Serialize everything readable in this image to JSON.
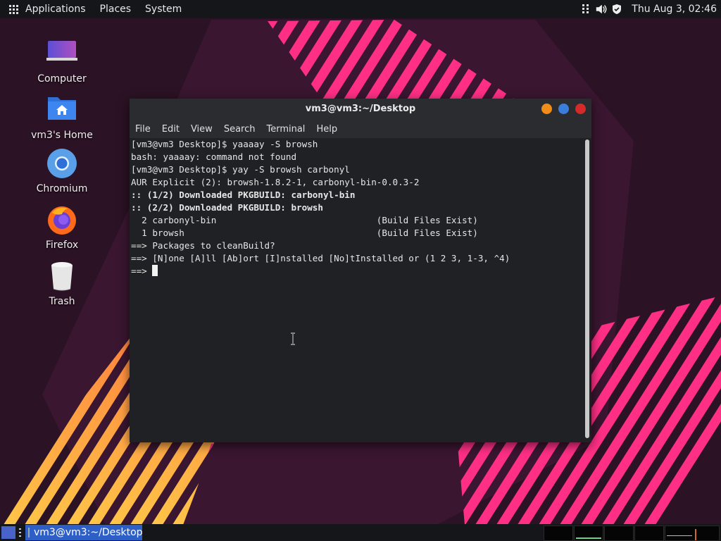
{
  "top_panel": {
    "menus": [
      "Applications",
      "Places",
      "System"
    ],
    "clock": "Thu Aug  3, 02:46",
    "tray_icons": [
      "network-icon",
      "volume-icon",
      "shield-icon"
    ]
  },
  "desktop_icons": [
    {
      "label": "Computer",
      "icon": "computer-icon"
    },
    {
      "label": "vm3's Home",
      "icon": "home-folder-icon"
    },
    {
      "label": "Chromium",
      "icon": "chromium-icon"
    },
    {
      "label": "Firefox",
      "icon": "firefox-icon"
    },
    {
      "label": "Trash",
      "icon": "trash-icon"
    }
  ],
  "window": {
    "title": "vm3@vm3:~/Desktop",
    "menu": [
      "File",
      "Edit",
      "View",
      "Search",
      "Terminal",
      "Help"
    ],
    "buttons": {
      "minimize": "#f08c1a",
      "maximize": "#3b7ddd",
      "close": "#d42a2a"
    }
  },
  "terminal": {
    "lines": [
      {
        "text": "[vm3@vm3 Desktop]$ yaaaay -S browsh",
        "bold": false
      },
      {
        "text": "bash: yaaaay: command not found",
        "bold": false
      },
      {
        "text": "[vm3@vm3 Desktop]$ yay -S browsh carbonyl",
        "bold": false
      },
      {
        "text": "AUR Explicit (2): browsh-1.8.2-1, carbonyl-bin-0.0.3-2",
        "bold": false
      },
      {
        "text": ":: (1/2) Downloaded PKGBUILD: carbonyl-bin",
        "bold": true
      },
      {
        "text": ":: (2/2) Downloaded PKGBUILD: browsh",
        "bold": true
      },
      {
        "text": "  2 carbonyl-bin                              (Build Files Exist)",
        "bold": false
      },
      {
        "text": "  1 browsh                                    (Build Files Exist)",
        "bold": false
      },
      {
        "text": "==> Packages to cleanBuild?",
        "bold": false
      },
      {
        "text": "==> [N]one [A]ll [Ab]ort [I]nstalled [No]tInstalled or (1 2 3, 1-3, ^4)",
        "bold": false
      }
    ],
    "prompt": "==> "
  },
  "taskbar": {
    "task_label": "vm3@vm3:~/Desktop",
    "accent": "#2e5fc7"
  }
}
